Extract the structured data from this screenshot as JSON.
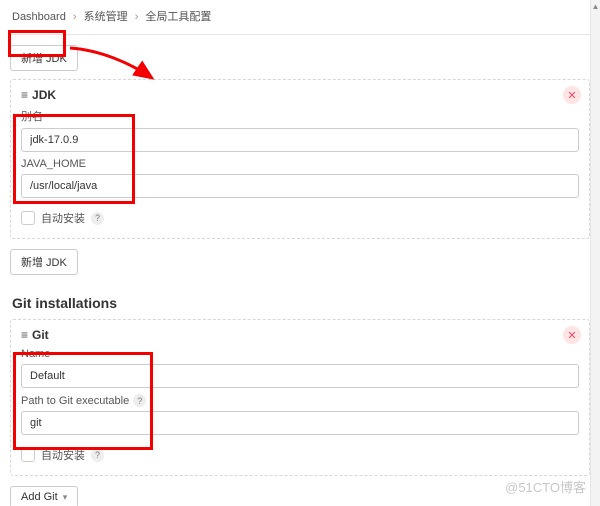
{
  "breadcrumb": {
    "items": [
      "Dashboard",
      "系统管理",
      "全局工具配置"
    ]
  },
  "buttons": {
    "add_jdk_top": "新增 JDK",
    "add_jdk_bottom": "新增 JDK",
    "add_git": "Add Git"
  },
  "jdk": {
    "header": "JDK",
    "alias_label": "别名",
    "alias_value": "jdk-17.0.9",
    "home_label": "JAVA_HOME",
    "home_value": "/usr/local/java",
    "auto_install_label": "自动安装"
  },
  "git_section": {
    "heading": "Git installations",
    "header": "Git",
    "name_label": "Name",
    "name_value": "Default",
    "path_label": "Path to Git executable",
    "path_value": "git",
    "auto_install_label": "自动安装"
  },
  "watermark": "@51CTO博客"
}
